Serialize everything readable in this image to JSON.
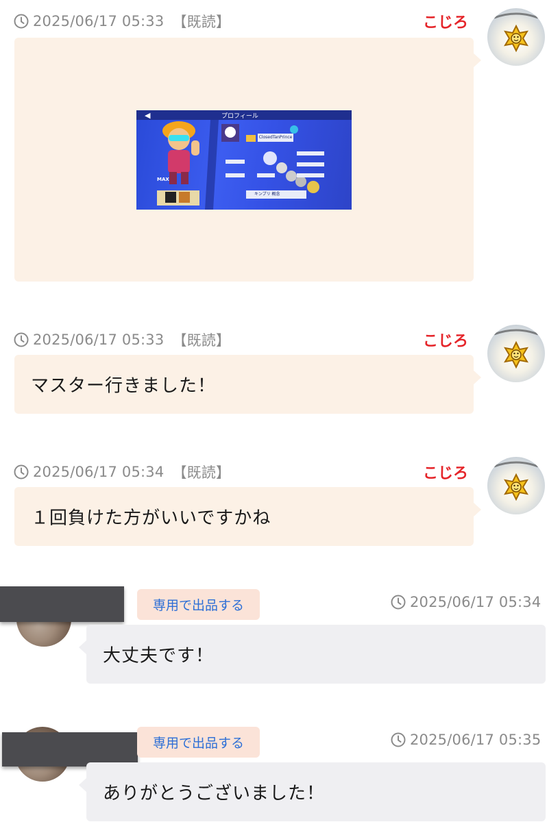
{
  "messages": [
    {
      "time": "2025/06/17 05:33",
      "read": "【既読】",
      "sender": "こじろ",
      "type": "image",
      "image_content": {
        "title": "プロフィール",
        "player_name": "ClosedTanPrince",
        "club_name": "キンプリ 概念",
        "power_label": "MAX"
      }
    },
    {
      "time": "2025/06/17 05:33",
      "read": "【既読】",
      "sender": "こじろ",
      "type": "text",
      "text": "マスター行きました！"
    },
    {
      "time": "2025/06/17 05:34",
      "read": "【既読】",
      "sender": "こじろ",
      "type": "text",
      "text": "１回負けた方がいいですかね"
    },
    {
      "time": "2025/06/17 05:34",
      "list_button": "専用で出品する",
      "type": "text",
      "text": "大丈夫です！"
    },
    {
      "time": "2025/06/17 05:35",
      "list_button": "専用で出品する",
      "type": "text",
      "text": "ありがとうございました！"
    }
  ],
  "icons": {
    "clock": "clock-icon",
    "seller_avatar": "star-badge-avatar",
    "buyer_avatar": "photo-avatar"
  },
  "colors": {
    "sender_name": "#e5252a",
    "seller_bubble": "#fcf1e6",
    "buyer_bubble": "#efeff2",
    "list_button_bg": "#fbe3d8",
    "list_button_text": "#2d6fd6",
    "meta_text": "#8b8b8b"
  }
}
